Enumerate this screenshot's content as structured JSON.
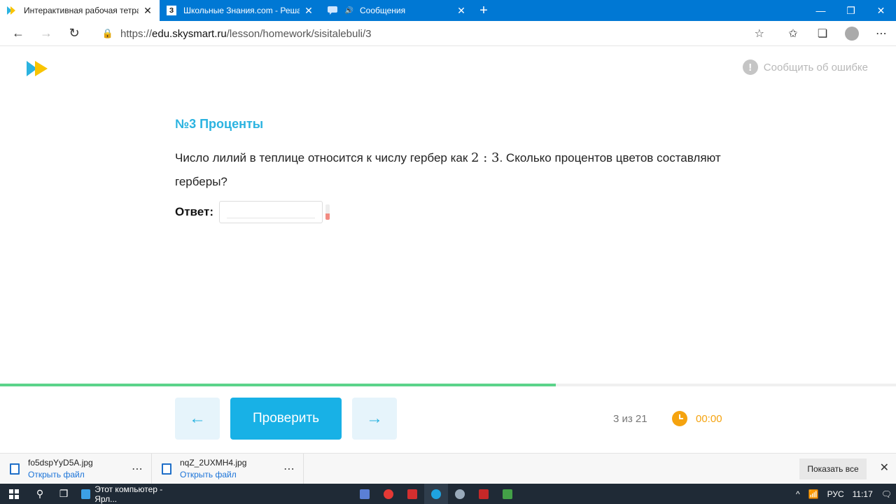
{
  "browser": {
    "tabs": [
      {
        "title": "Интерактивная рабочая тетрадь",
        "favicon": "skysmart-icon",
        "active": true
      },
      {
        "title": "Школьные Знания.com - Решаем",
        "favicon": "znania-icon",
        "favicon_text": "З"
      },
      {
        "title": "Сообщения",
        "favicon": "messages-icon"
      }
    ],
    "new_tab": "+",
    "address": {
      "prefix": "https://",
      "host": "edu.skysmart.ru",
      "path": "/lesson/homework/sisitalebuli/3"
    }
  },
  "page": {
    "report_label": "Сообщить об ошибке",
    "task_title": "№3 Проценты",
    "task_text_before": "Число лилий в теплице относится к числу гербер как ",
    "task_ratio": "2 : 3",
    "task_text_after": ". Сколько процентов цветов составляют герберы?",
    "answer_label": "Ответ:",
    "answer_value": "",
    "progress_fraction": 0.62,
    "check_label": "Проверить",
    "prev_arrow": "←",
    "next_arrow": "→",
    "counter": "3 из 21",
    "timer": "00:00"
  },
  "downloads": {
    "items": [
      {
        "name": "fo5dspYyD5A.jpg",
        "action": "Открыть файл"
      },
      {
        "name": "nqZ_2UXMH4.jpg",
        "action": "Открыть файл"
      }
    ],
    "show_all": "Показать все"
  },
  "taskbar": {
    "app_label": "Этот компьютер - Ярл...",
    "lang": "РУС",
    "time": "11:17"
  },
  "colors": {
    "accent": "#18b1e6",
    "title_blue": "#2bb3e0",
    "progress_green": "#5bd38a",
    "timer_orange": "#f5a30f",
    "edge_blue": "#0078d4"
  }
}
